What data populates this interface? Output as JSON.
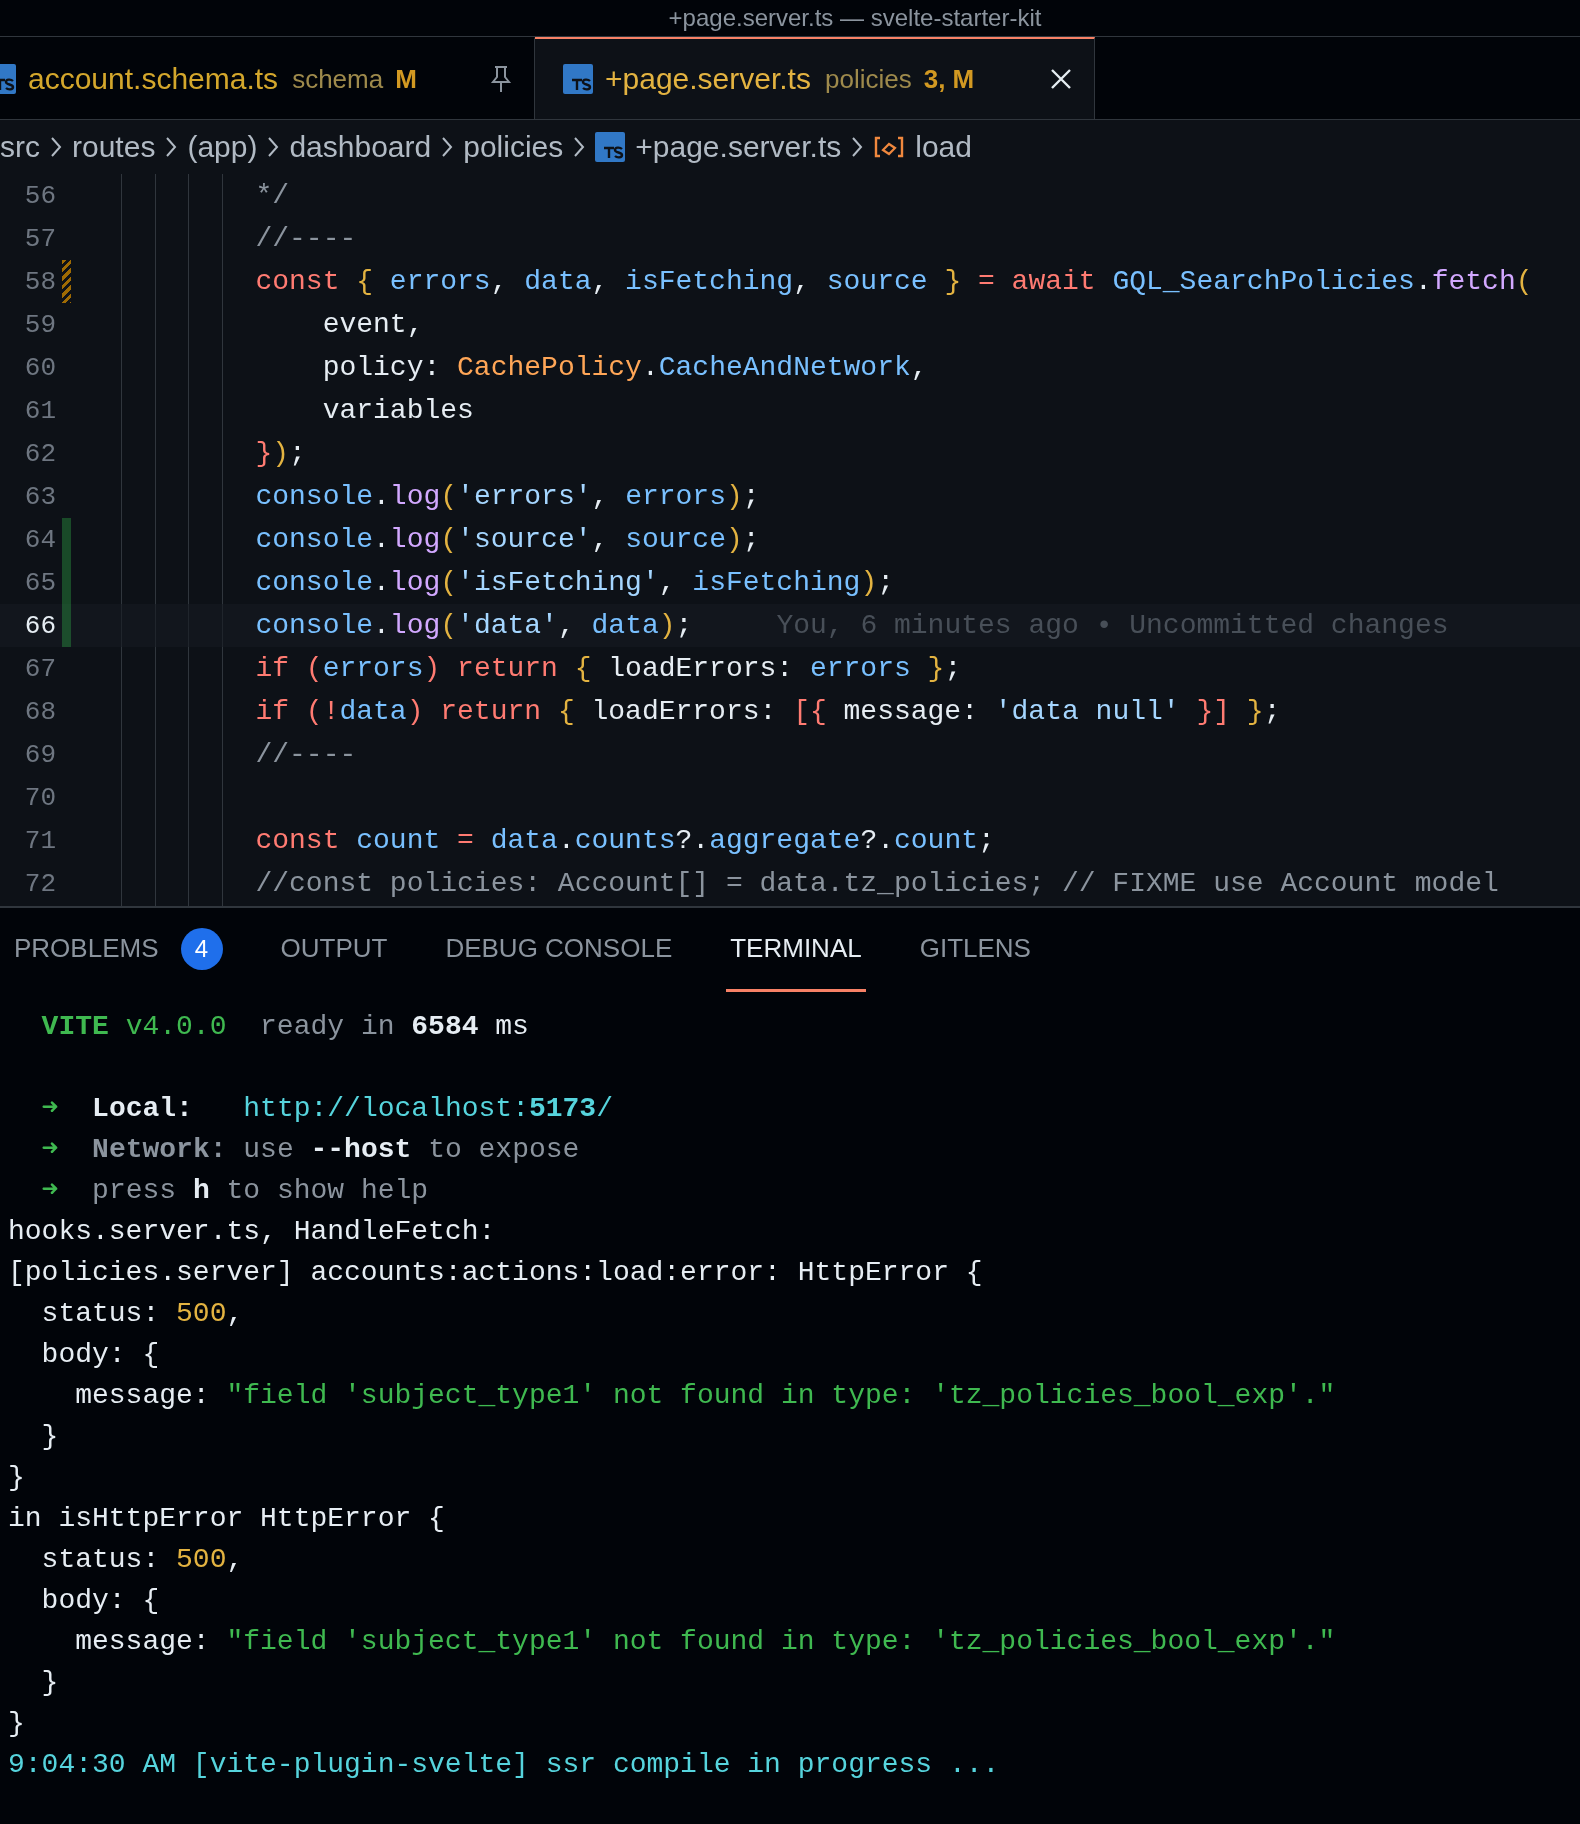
{
  "window": {
    "title": "+page.server.ts — svelte-starter-kit"
  },
  "tabs": [
    {
      "label": "account.schema.ts",
      "folder": "schema",
      "status": "M",
      "selected": false,
      "pinned": true
    },
    {
      "label": "+page.server.ts",
      "folder": "policies",
      "status": "3, M",
      "selected": true,
      "pinned": false
    }
  ],
  "breadcrumb": [
    {
      "label": "src",
      "kind": "folder"
    },
    {
      "label": "routes",
      "kind": "folder"
    },
    {
      "label": "(app)",
      "kind": "folder"
    },
    {
      "label": "dashboard",
      "kind": "folder"
    },
    {
      "label": "policies",
      "kind": "folder"
    },
    {
      "label": "+page.server.ts",
      "kind": "file"
    },
    {
      "label": "load",
      "kind": "symbol"
    }
  ],
  "code": [
    {
      "number": "56",
      "current": false,
      "added": false,
      "modified": false,
      "tokens": [
        {
          "text": "        */",
          "kind": "comment"
        }
      ]
    },
    {
      "number": "57",
      "current": false,
      "added": false,
      "modified": false,
      "tokens": [
        {
          "text": "        //----",
          "kind": "comment"
        }
      ]
    },
    {
      "number": "58",
      "current": false,
      "added": false,
      "modified": true,
      "tokens": [
        {
          "text": "        const",
          "kind": "kw"
        },
        {
          "text": " {",
          "kind": "brace"
        },
        {
          "text": " errors",
          "kind": "var"
        },
        {
          "text": ", ",
          "kind": "plain"
        },
        {
          "text": "data",
          "kind": "var"
        },
        {
          "text": ", ",
          "kind": "plain"
        },
        {
          "text": "isFetching",
          "kind": "var"
        },
        {
          "text": ", ",
          "kind": "plain"
        },
        {
          "text": "source",
          "kind": "var"
        },
        {
          "text": " }",
          "kind": "brace"
        },
        {
          "text": " = await",
          "kind": "kw"
        },
        {
          "text": " GQL_SearchPolicies",
          "kind": "var"
        },
        {
          "text": ".",
          "kind": "plain"
        },
        {
          "text": "fetch",
          "kind": "fn"
        },
        {
          "text": "(",
          "kind": "brace"
        }
      ]
    },
    {
      "number": "59",
      "current": false,
      "added": false,
      "modified": false,
      "tokens": [
        {
          "text": "            event,",
          "kind": "plain"
        }
      ]
    },
    {
      "number": "60",
      "current": false,
      "added": false,
      "modified": false,
      "tokens": [
        {
          "text": "            policy: ",
          "kind": "plain"
        },
        {
          "text": "CachePolicy",
          "kind": "type"
        },
        {
          "text": ".",
          "kind": "plain"
        },
        {
          "text": "CacheAndNetwork",
          "kind": "var"
        },
        {
          "text": ",",
          "kind": "plain"
        }
      ]
    },
    {
      "number": "61",
      "current": false,
      "added": false,
      "modified": false,
      "tokens": [
        {
          "text": "            variables",
          "kind": "plain"
        }
      ]
    },
    {
      "number": "62",
      "current": false,
      "added": false,
      "modified": false,
      "tokens": [
        {
          "text": "        }",
          "kind": "kw"
        },
        {
          "text": ")",
          "kind": "brace"
        },
        {
          "text": ";",
          "kind": "plain"
        }
      ]
    },
    {
      "number": "63",
      "current": false,
      "added": false,
      "modified": false,
      "tokens": [
        {
          "text": "        console",
          "kind": "var"
        },
        {
          "text": ".",
          "kind": "plain"
        },
        {
          "text": "log",
          "kind": "fn"
        },
        {
          "text": "(",
          "kind": "brace"
        },
        {
          "text": "'errors'",
          "kind": "str"
        },
        {
          "text": ", ",
          "kind": "plain"
        },
        {
          "text": "errors",
          "kind": "var"
        },
        {
          "text": ")",
          "kind": "brace"
        },
        {
          "text": ";",
          "kind": "plain"
        }
      ]
    },
    {
      "number": "64",
      "current": false,
      "added": true,
      "modified": false,
      "tokens": [
        {
          "text": "        console",
          "kind": "var"
        },
        {
          "text": ".",
          "kind": "plain"
        },
        {
          "text": "log",
          "kind": "fn"
        },
        {
          "text": "(",
          "kind": "brace"
        },
        {
          "text": "'source'",
          "kind": "str"
        },
        {
          "text": ", ",
          "kind": "plain"
        },
        {
          "text": "source",
          "kind": "var"
        },
        {
          "text": ")",
          "kind": "brace"
        },
        {
          "text": ";",
          "kind": "plain"
        }
      ]
    },
    {
      "number": "65",
      "current": false,
      "added": true,
      "modified": false,
      "tokens": [
        {
          "text": "        console",
          "kind": "var"
        },
        {
          "text": ".",
          "kind": "plain"
        },
        {
          "text": "log",
          "kind": "fn"
        },
        {
          "text": "(",
          "kind": "brace"
        },
        {
          "text": "'isFetching'",
          "kind": "str"
        },
        {
          "text": ", ",
          "kind": "plain"
        },
        {
          "text": "isFetching",
          "kind": "var"
        },
        {
          "text": ")",
          "kind": "brace"
        },
        {
          "text": ";",
          "kind": "plain"
        }
      ]
    },
    {
      "number": "66",
      "current": true,
      "added": true,
      "modified": false,
      "blame": "You, 6 minutes ago • Uncommitted changes",
      "tokens": [
        {
          "text": "        console",
          "kind": "var"
        },
        {
          "text": ".",
          "kind": "plain"
        },
        {
          "text": "log",
          "kind": "fn"
        },
        {
          "text": "(",
          "kind": "brace"
        },
        {
          "text": "'data'",
          "kind": "str"
        },
        {
          "text": ", ",
          "kind": "plain"
        },
        {
          "text": "data",
          "kind": "var"
        },
        {
          "text": ")",
          "kind": "brace"
        },
        {
          "text": ";",
          "kind": "plain"
        }
      ]
    },
    {
      "number": "67",
      "current": false,
      "added": false,
      "modified": false,
      "tokens": [
        {
          "text": "        if (",
          "kind": "kw"
        },
        {
          "text": "errors",
          "kind": "var"
        },
        {
          "text": ") return",
          "kind": "kw"
        },
        {
          "text": " {",
          "kind": "brace"
        },
        {
          "text": " loadErrors: ",
          "kind": "plain"
        },
        {
          "text": "errors",
          "kind": "var"
        },
        {
          "text": " }",
          "kind": "brace"
        },
        {
          "text": ";",
          "kind": "plain"
        }
      ]
    },
    {
      "number": "68",
      "current": false,
      "added": false,
      "modified": false,
      "tokens": [
        {
          "text": "        if (!",
          "kind": "kw"
        },
        {
          "text": "data",
          "kind": "var"
        },
        {
          "text": ") return",
          "kind": "kw"
        },
        {
          "text": " {",
          "kind": "brace"
        },
        {
          "text": " loadErrors: ",
          "kind": "plain"
        },
        {
          "text": "[{",
          "kind": "kw"
        },
        {
          "text": " message: ",
          "kind": "plain"
        },
        {
          "text": "'data null'",
          "kind": "str"
        },
        {
          "text": " }]",
          "kind": "kw"
        },
        {
          "text": " }",
          "kind": "brace"
        },
        {
          "text": ";",
          "kind": "plain"
        }
      ]
    },
    {
      "number": "69",
      "current": false,
      "added": false,
      "modified": false,
      "tokens": [
        {
          "text": "        //----",
          "kind": "comment"
        }
      ]
    },
    {
      "number": "70",
      "current": false,
      "added": false,
      "modified": false
    },
    {
      "number": "71",
      "current": false,
      "added": false,
      "modified": false,
      "tokens": [
        {
          "text": "        const",
          "kind": "kw"
        },
        {
          "text": " count",
          "kind": "var"
        },
        {
          "text": " =",
          "kind": "kw"
        },
        {
          "text": " data",
          "kind": "var"
        },
        {
          "text": ".",
          "kind": "plain"
        },
        {
          "text": "counts",
          "kind": "var"
        },
        {
          "text": "?.",
          "kind": "plain"
        },
        {
          "text": "aggregate",
          "kind": "var"
        },
        {
          "text": "?.",
          "kind": "plain"
        },
        {
          "text": "count",
          "kind": "var"
        },
        {
          "text": ";",
          "kind": "plain"
        }
      ]
    },
    {
      "number": "72",
      "current": false,
      "added": false,
      "modified": false,
      "tokens": [
        {
          "text": "        //const policies: Account[] = data.tz_policies; // FIXME use Account model",
          "kind": "comment"
        }
      ]
    }
  ],
  "panel_tabs": [
    {
      "label": "PROBLEMS",
      "badge": "4",
      "selected": false
    },
    {
      "label": "OUTPUT",
      "selected": false
    },
    {
      "label": "DEBUG CONSOLE",
      "selected": false
    },
    {
      "label": "TERMINAL",
      "selected": true
    },
    {
      "label": "GITLENS",
      "selected": false
    }
  ],
  "terminal": [
    {
      "lines": [
        {
          "segments": [
            {
              "text": "  VITE",
              "kind": "vite"
            },
            {
              "text": " v4.0.0",
              "kind": "green"
            },
            {
              "text": "  ready in ",
              "kind": "dim"
            },
            {
              "text": "6584",
              "kind": "bold"
            },
            {
              "text": " ms",
              "kind": "plain"
            }
          ]
        }
      ]
    },
    {
      "lines": [
        {
          "segments": [
            {
              "text": "  ➜",
              "kind": "green"
            },
            {
              "text": "  Local:",
              "kind": "bold"
            },
            {
              "text": "   http://localhost:",
              "kind": "link"
            },
            {
              "text": "5173",
              "kind": "link-bold"
            },
            {
              "text": "/",
              "kind": "link"
            }
          ]
        },
        {
          "segments": [
            {
              "text": "  ➜",
              "kind": "green"
            },
            {
              "text": "  Network:",
              "kind": "dim-bold"
            },
            {
              "text": " use ",
              "kind": "dim"
            },
            {
              "text": "--host",
              "kind": "bold"
            },
            {
              "text": " to expose",
              "kind": "dim"
            }
          ]
        },
        {
          "segments": [
            {
              "text": "  ➜",
              "kind": "green"
            },
            {
              "text": "  press ",
              "kind": "dim"
            },
            {
              "text": "h",
              "kind": "bold"
            },
            {
              "text": " to show help",
              "kind": "dim"
            }
          ]
        },
        {
          "segments": [
            {
              "text": "hooks.server.ts, HandleFetch:",
              "kind": "plain"
            }
          ]
        },
        {
          "segments": [
            {
              "text": "[policies.server] accounts:actions:load:error: HttpError {",
              "kind": "plain"
            }
          ]
        },
        {
          "segments": [
            {
              "text": "  status: ",
              "kind": "plain"
            },
            {
              "text": "500",
              "kind": "number"
            },
            {
              "text": ",",
              "kind": "plain"
            }
          ]
        },
        {
          "segments": [
            {
              "text": "  body: {",
              "kind": "plain"
            }
          ]
        },
        {
          "segments": [
            {
              "text": "    message: ",
              "kind": "plain"
            },
            {
              "text": "\"field 'subject_type1' not found in type: 'tz_policies_bool_exp'.\"",
              "kind": "string"
            }
          ]
        },
        {
          "segments": [
            {
              "text": "  }",
              "kind": "plain"
            }
          ]
        },
        {
          "segments": [
            {
              "text": "}",
              "kind": "plain"
            }
          ]
        },
        {
          "segments": [
            {
              "text": "in isHttpError HttpError {",
              "kind": "plain"
            }
          ]
        },
        {
          "segments": [
            {
              "text": "  status: ",
              "kind": "plain"
            },
            {
              "text": "500",
              "kind": "number"
            },
            {
              "text": ",",
              "kind": "plain"
            }
          ]
        },
        {
          "segments": [
            {
              "text": "  body: {",
              "kind": "plain"
            }
          ]
        },
        {
          "segments": [
            {
              "text": "    message: ",
              "kind": "plain"
            },
            {
              "text": "\"field 'subject_type1' not found in type: 'tz_policies_bool_exp'.\"",
              "kind": "string"
            }
          ]
        },
        {
          "segments": [
            {
              "text": "  }",
              "kind": "plain"
            }
          ]
        },
        {
          "segments": [
            {
              "text": "}",
              "kind": "plain"
            }
          ]
        },
        {
          "segments": [
            {
              "text": "9:04:30 AM [vite-plugin-svelte] ssr compile in progress ...",
              "kind": "info"
            }
          ]
        }
      ]
    }
  ]
}
